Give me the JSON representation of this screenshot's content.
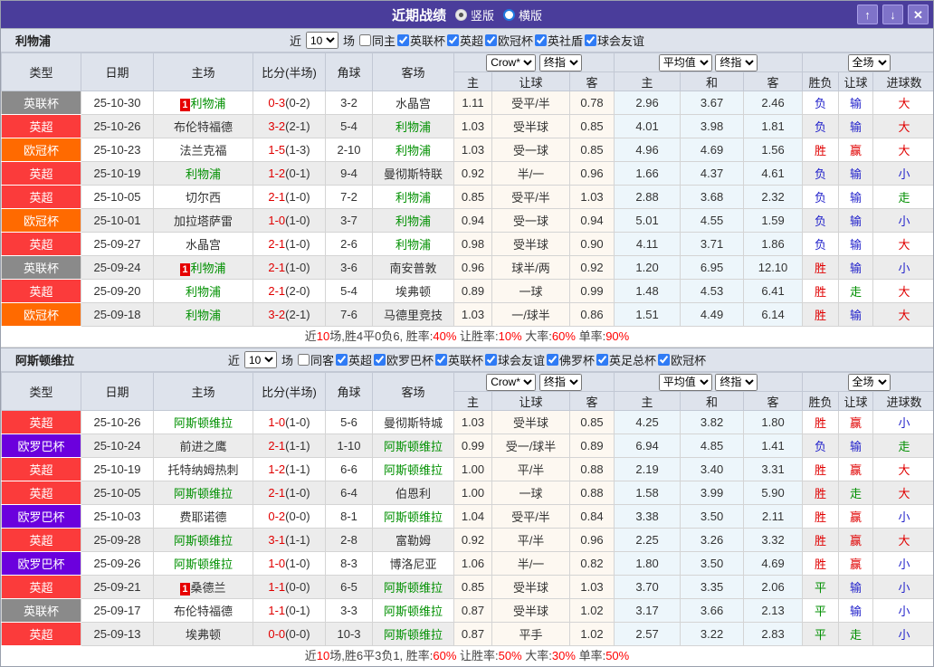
{
  "titlebar": {
    "title": "近期战绩",
    "radio_vertical": "竖版",
    "radio_horizontal": "横版",
    "up_icon": "↑",
    "down_icon": "↓",
    "close_icon": "✕"
  },
  "filter_labels": {
    "near": "近",
    "games": "场"
  },
  "table": {
    "headers_main": [
      "类型",
      "日期",
      "主场",
      "比分(半场)",
      "角球",
      "客场"
    ],
    "headers_sub": [
      "主",
      "让球",
      "客",
      "主",
      "和",
      "客",
      "胜负",
      "让球",
      "进球数"
    ],
    "select_crow": "Crow*",
    "select_final1": "终指",
    "select_avg": "平均值",
    "select_final2": "终指",
    "select_full": "全场"
  },
  "colors": {
    "titlebar": "#4a3d9b",
    "accent_red": "#e00000",
    "accent_blue": "#2323cb",
    "accent_green": "#008f00",
    "comp": {
      "英超": "#fb3b3b",
      "欧冠杯": "#ff6a00",
      "英联杯": "#8a8a8a",
      "欧罗巴杯": "#6b00dd"
    }
  },
  "sections": [
    {
      "team": "利物浦",
      "count": "10",
      "filters": [
        {
          "label": "同主",
          "checked": false
        },
        {
          "label": "英联杯",
          "checked": true
        },
        {
          "label": "英超",
          "checked": true
        },
        {
          "label": "欧冠杯",
          "checked": true
        },
        {
          "label": "英社盾",
          "checked": true
        },
        {
          "label": "球会友谊",
          "checked": true
        }
      ],
      "rows": [
        {
          "type": "英联杯",
          "date": "25-10-30",
          "home": {
            "name": "利物浦",
            "self": true,
            "badge": "1"
          },
          "score": "0-3",
          "half": "(0-2)",
          "corner": "3-2",
          "away": {
            "name": "水晶宫"
          },
          "o1": [
            "1.11",
            "受平/半",
            "0.78"
          ],
          "o2": [
            "2.96",
            "3.67",
            "2.46"
          ],
          "r": [
            "负",
            "b"
          ],
          "l": [
            "输",
            "b"
          ],
          "g": [
            "大",
            "r"
          ]
        },
        {
          "type": "英超",
          "date": "25-10-26",
          "home": {
            "name": "布伦特福德"
          },
          "score": "3-2",
          "half": "(2-1)",
          "corner": "5-4",
          "away": {
            "name": "利物浦",
            "self": true
          },
          "o1": [
            "1.03",
            "受半球",
            "0.85"
          ],
          "o2": [
            "4.01",
            "3.98",
            "1.81"
          ],
          "r": [
            "负",
            "b"
          ],
          "l": [
            "输",
            "b"
          ],
          "g": [
            "大",
            "r"
          ]
        },
        {
          "type": "欧冠杯",
          "date": "25-10-23",
          "home": {
            "name": "法兰克福"
          },
          "score": "1-5",
          "half": "(1-3)",
          "corner": "2-10",
          "away": {
            "name": "利物浦",
            "self": true
          },
          "o1": [
            "1.03",
            "受一球",
            "0.85"
          ],
          "o2": [
            "4.96",
            "4.69",
            "1.56"
          ],
          "r": [
            "胜",
            "r"
          ],
          "l": [
            "赢",
            "r"
          ],
          "g": [
            "大",
            "r"
          ]
        },
        {
          "type": "英超",
          "date": "25-10-19",
          "home": {
            "name": "利物浦",
            "self": true
          },
          "score": "1-2",
          "half": "(0-1)",
          "corner": "9-4",
          "away": {
            "name": "曼彻斯特联"
          },
          "o1": [
            "0.92",
            "半/一",
            "0.96"
          ],
          "o2": [
            "1.66",
            "4.37",
            "4.61"
          ],
          "r": [
            "负",
            "b"
          ],
          "l": [
            "输",
            "b"
          ],
          "g": [
            "小",
            "b"
          ]
        },
        {
          "type": "英超",
          "date": "25-10-05",
          "home": {
            "name": "切尔西"
          },
          "score": "2-1",
          "half": "(1-0)",
          "corner": "7-2",
          "away": {
            "name": "利物浦",
            "self": true
          },
          "o1": [
            "0.85",
            "受平/半",
            "1.03"
          ],
          "o2": [
            "2.88",
            "3.68",
            "2.32"
          ],
          "r": [
            "负",
            "b"
          ],
          "l": [
            "输",
            "b"
          ],
          "g": [
            "走",
            "g"
          ]
        },
        {
          "type": "欧冠杯",
          "date": "25-10-01",
          "home": {
            "name": "加拉塔萨雷"
          },
          "score": "1-0",
          "half": "(1-0)",
          "corner": "3-7",
          "away": {
            "name": "利物浦",
            "self": true
          },
          "o1": [
            "0.94",
            "受一球",
            "0.94"
          ],
          "o2": [
            "5.01",
            "4.55",
            "1.59"
          ],
          "r": [
            "负",
            "b"
          ],
          "l": [
            "输",
            "b"
          ],
          "g": [
            "小",
            "b"
          ]
        },
        {
          "type": "英超",
          "date": "25-09-27",
          "home": {
            "name": "水晶宫"
          },
          "score": "2-1",
          "half": "(1-0)",
          "corner": "2-6",
          "away": {
            "name": "利物浦",
            "self": true
          },
          "o1": [
            "0.98",
            "受半球",
            "0.90"
          ],
          "o2": [
            "4.11",
            "3.71",
            "1.86"
          ],
          "r": [
            "负",
            "b"
          ],
          "l": [
            "输",
            "b"
          ],
          "g": [
            "大",
            "r"
          ]
        },
        {
          "type": "英联杯",
          "date": "25-09-24",
          "home": {
            "name": "利物浦",
            "self": true,
            "badge": "1"
          },
          "score": "2-1",
          "half": "(1-0)",
          "corner": "3-6",
          "away": {
            "name": "南安普敦"
          },
          "o1": [
            "0.96",
            "球半/两",
            "0.92"
          ],
          "o2": [
            "1.20",
            "6.95",
            "12.10"
          ],
          "r": [
            "胜",
            "r"
          ],
          "l": [
            "输",
            "b"
          ],
          "g": [
            "小",
            "b"
          ]
        },
        {
          "type": "英超",
          "date": "25-09-20",
          "home": {
            "name": "利物浦",
            "self": true
          },
          "score": "2-1",
          "half": "(2-0)",
          "corner": "5-4",
          "away": {
            "name": "埃弗顿"
          },
          "o1": [
            "0.89",
            "一球",
            "0.99"
          ],
          "o2": [
            "1.48",
            "4.53",
            "6.41"
          ],
          "r": [
            "胜",
            "r"
          ],
          "l": [
            "走",
            "g"
          ],
          "g": [
            "大",
            "r"
          ]
        },
        {
          "type": "欧冠杯",
          "date": "25-09-18",
          "home": {
            "name": "利物浦",
            "self": true
          },
          "score": "3-2",
          "half": "(2-1)",
          "corner": "7-6",
          "away": {
            "name": "马德里竞技"
          },
          "o1": [
            "1.03",
            "一/球半",
            "0.86"
          ],
          "o2": [
            "1.51",
            "4.49",
            "6.14"
          ],
          "r": [
            "胜",
            "r"
          ],
          "l": [
            "输",
            "b"
          ],
          "g": [
            "大",
            "r"
          ]
        }
      ],
      "summary": [
        {
          "t": "近"
        },
        {
          "t": "10",
          "red": true
        },
        {
          "t": "场,胜4平0负6, 胜率:"
        },
        {
          "t": "40%",
          "red": true
        },
        {
          "t": " 让胜率:"
        },
        {
          "t": "10%",
          "red": true
        },
        {
          "t": " 大率:"
        },
        {
          "t": "60%",
          "red": true
        },
        {
          "t": " 单率:"
        },
        {
          "t": "90%",
          "red": true
        }
      ]
    },
    {
      "team": "阿斯顿维拉",
      "count": "10",
      "filters": [
        {
          "label": "同客",
          "checked": false
        },
        {
          "label": "英超",
          "checked": true
        },
        {
          "label": "欧罗巴杯",
          "checked": true
        },
        {
          "label": "英联杯",
          "checked": true
        },
        {
          "label": "球会友谊",
          "checked": true
        },
        {
          "label": "佛罗杯",
          "checked": true
        },
        {
          "label": "英足总杯",
          "checked": true
        },
        {
          "label": "欧冠杯",
          "checked": true
        }
      ],
      "rows": [
        {
          "type": "英超",
          "date": "25-10-26",
          "home": {
            "name": "阿斯顿维拉",
            "self": true
          },
          "score": "1-0",
          "half": "(1-0)",
          "corner": "5-6",
          "away": {
            "name": "曼彻斯特城"
          },
          "o1": [
            "1.03",
            "受半球",
            "0.85"
          ],
          "o2": [
            "4.25",
            "3.82",
            "1.80"
          ],
          "r": [
            "胜",
            "r"
          ],
          "l": [
            "赢",
            "r"
          ],
          "g": [
            "小",
            "b"
          ]
        },
        {
          "type": "欧罗巴杯",
          "date": "25-10-24",
          "home": {
            "name": "前进之鹰"
          },
          "score": "2-1",
          "half": "(1-1)",
          "corner": "1-10",
          "away": {
            "name": "阿斯顿维拉",
            "self": true
          },
          "o1": [
            "0.99",
            "受一/球半",
            "0.89"
          ],
          "o2": [
            "6.94",
            "4.85",
            "1.41"
          ],
          "r": [
            "负",
            "b"
          ],
          "l": [
            "输",
            "b"
          ],
          "g": [
            "走",
            "g"
          ]
        },
        {
          "type": "英超",
          "date": "25-10-19",
          "home": {
            "name": "托特纳姆热刺"
          },
          "score": "1-2",
          "half": "(1-1)",
          "corner": "6-6",
          "away": {
            "name": "阿斯顿维拉",
            "self": true
          },
          "o1": [
            "1.00",
            "平/半",
            "0.88"
          ],
          "o2": [
            "2.19",
            "3.40",
            "3.31"
          ],
          "r": [
            "胜",
            "r"
          ],
          "l": [
            "赢",
            "r"
          ],
          "g": [
            "大",
            "r"
          ]
        },
        {
          "type": "英超",
          "date": "25-10-05",
          "home": {
            "name": "阿斯顿维拉",
            "self": true
          },
          "score": "2-1",
          "half": "(1-0)",
          "corner": "6-4",
          "away": {
            "name": "伯恩利"
          },
          "o1": [
            "1.00",
            "一球",
            "0.88"
          ],
          "o2": [
            "1.58",
            "3.99",
            "5.90"
          ],
          "r": [
            "胜",
            "r"
          ],
          "l": [
            "走",
            "g"
          ],
          "g": [
            "大",
            "r"
          ]
        },
        {
          "type": "欧罗巴杯",
          "date": "25-10-03",
          "home": {
            "name": "费耶诺德"
          },
          "score": "0-2",
          "half": "(0-0)",
          "corner": "8-1",
          "away": {
            "name": "阿斯顿维拉",
            "self": true
          },
          "o1": [
            "1.04",
            "受平/半",
            "0.84"
          ],
          "o2": [
            "3.38",
            "3.50",
            "2.11"
          ],
          "r": [
            "胜",
            "r"
          ],
          "l": [
            "赢",
            "r"
          ],
          "g": [
            "小",
            "b"
          ]
        },
        {
          "type": "英超",
          "date": "25-09-28",
          "home": {
            "name": "阿斯顿维拉",
            "self": true
          },
          "score": "3-1",
          "half": "(1-1)",
          "corner": "2-8",
          "away": {
            "name": "富勒姆"
          },
          "o1": [
            "0.92",
            "平/半",
            "0.96"
          ],
          "o2": [
            "2.25",
            "3.26",
            "3.32"
          ],
          "r": [
            "胜",
            "r"
          ],
          "l": [
            "赢",
            "r"
          ],
          "g": [
            "大",
            "r"
          ]
        },
        {
          "type": "欧罗巴杯",
          "date": "25-09-26",
          "home": {
            "name": "阿斯顿维拉",
            "self": true
          },
          "score": "1-0",
          "half": "(1-0)",
          "corner": "8-3",
          "away": {
            "name": "博洛尼亚"
          },
          "o1": [
            "1.06",
            "半/一",
            "0.82"
          ],
          "o2": [
            "1.80",
            "3.50",
            "4.69"
          ],
          "r": [
            "胜",
            "r"
          ],
          "l": [
            "赢",
            "r"
          ],
          "g": [
            "小",
            "b"
          ]
        },
        {
          "type": "英超",
          "date": "25-09-21",
          "home": {
            "name": "桑德兰",
            "badge": "1"
          },
          "score": "1-1",
          "half": "(0-0)",
          "corner": "6-5",
          "away": {
            "name": "阿斯顿维拉",
            "self": true
          },
          "o1": [
            "0.85",
            "受半球",
            "1.03"
          ],
          "o2": [
            "3.70",
            "3.35",
            "2.06"
          ],
          "r": [
            "平",
            "g"
          ],
          "l": [
            "输",
            "b"
          ],
          "g": [
            "小",
            "b"
          ]
        },
        {
          "type": "英联杯",
          "date": "25-09-17",
          "home": {
            "name": "布伦特福德"
          },
          "score": "1-1",
          "half": "(0-1)",
          "corner": "3-3",
          "away": {
            "name": "阿斯顿维拉",
            "self": true
          },
          "o1": [
            "0.87",
            "受半球",
            "1.02"
          ],
          "o2": [
            "3.17",
            "3.66",
            "2.13"
          ],
          "r": [
            "平",
            "g"
          ],
          "l": [
            "输",
            "b"
          ],
          "g": [
            "小",
            "b"
          ]
        },
        {
          "type": "英超",
          "date": "25-09-13",
          "home": {
            "name": "埃弗顿"
          },
          "score": "0-0",
          "half": "(0-0)",
          "corner": "10-3",
          "away": {
            "name": "阿斯顿维拉",
            "self": true
          },
          "o1": [
            "0.87",
            "平手",
            "1.02"
          ],
          "o2": [
            "2.57",
            "3.22",
            "2.83"
          ],
          "r": [
            "平",
            "g"
          ],
          "l": [
            "走",
            "g"
          ],
          "g": [
            "小",
            "b"
          ]
        }
      ],
      "summary": [
        {
          "t": "近"
        },
        {
          "t": "10",
          "red": true
        },
        {
          "t": "场,胜6平3负1, 胜率:"
        },
        {
          "t": "60%",
          "red": true
        },
        {
          "t": " 让胜率:"
        },
        {
          "t": "50%",
          "red": true
        },
        {
          "t": " 大率:"
        },
        {
          "t": "30%",
          "red": true
        },
        {
          "t": " 单率:"
        },
        {
          "t": "50%",
          "red": true
        }
      ]
    }
  ]
}
